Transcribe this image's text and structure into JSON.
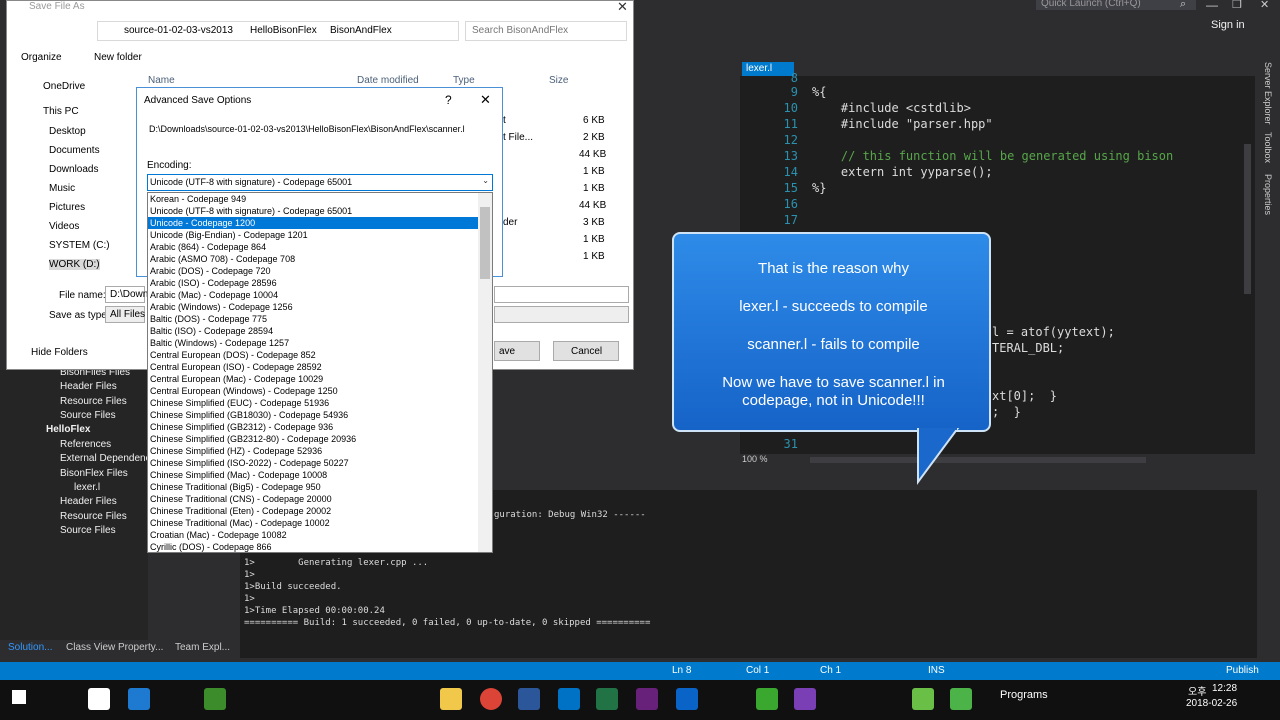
{
  "ide": {
    "quick_launch": "Quick Launch (Ctrl+Q)",
    "sign_in": "Sign in",
    "editor_tab": "lexer.l",
    "gutter": [
      "8",
      "9",
      "10",
      "11",
      "12",
      "13",
      "14",
      "15",
      "16",
      "17",
      "31"
    ],
    "code": [
      "%{",
      "    #include <cstdlib>",
      "    #include \"parser.hpp\"",
      "",
      "    // this function will be generated using bison",
      "    extern int yyparse();",
      "%}"
    ],
    "partial_code": [
      "l = atof(yytext);",
      "TERAL_DBL;",
      "xt[0];  }",
      ";  }"
    ],
    "zoom": "100 %",
    "side_tabs": [
      "Server Explorer",
      "Toolbox",
      "Properties"
    ]
  },
  "solution": {
    "items": [
      "BisonFiles Files",
      "Header Files",
      "Resource Files",
      "Source Files",
      "HelloFlex",
      "References",
      "External Dependencies",
      "BisonFlex Files",
      "lexer.l",
      "Header Files",
      "Resource Files",
      "Source Files"
    ],
    "tabs": [
      "Solution...",
      "Class View",
      "Property...",
      "Team Expl..."
    ]
  },
  "output": {
    "config_line": "guration: Debug Win32 ------",
    "lines": [
      "1>        Generating lexer.cpp ...",
      "1>",
      "1>Build succeeded.",
      "1>",
      "1>Time Elapsed 00:00:00.24",
      "========== Build: 1 succeeded, 0 failed, 0 up-to-date, 0 skipped =========="
    ]
  },
  "status": {
    "ln": "Ln 8",
    "col": "Col 1",
    "ch": "Ch 1",
    "ins": "INS",
    "publish": "Publish"
  },
  "taskbar": {
    "programs": "Programs",
    "time": "12:28",
    "ampm": "오후",
    "date": "2018-02-26"
  },
  "save_dialog": {
    "title": "Save File As",
    "path": [
      "source-01-02-03-vs2013",
      "HelloBisonFlex",
      "BisonAndFlex"
    ],
    "search": "Search BisonAndFlex",
    "organize": "Organize",
    "new_folder": "New folder",
    "columns": [
      "Name",
      "Date modified",
      "Type",
      "Size"
    ],
    "nav": [
      "OneDrive",
      "This PC",
      "Desktop",
      "Documents",
      "Downloads",
      "Music",
      "Pictures",
      "Videos",
      "SYSTEM (C:)",
      "WORK (D:)"
    ],
    "sizes": [
      "6 KB",
      "2 KB",
      "44 KB",
      "1 KB",
      "1 KB",
      "44 KB",
      "3 KB",
      "1 KB",
      "1 KB"
    ],
    "type_frag": [
      "t",
      "t File...",
      "",
      "",
      "",
      "",
      "der",
      "",
      ""
    ],
    "file_name_label": "File name:",
    "file_name": "D:\\Down",
    "save_as_label": "Save as type:",
    "save_as": "All Files",
    "hide_folders": "Hide Folders",
    "save": "ave",
    "cancel": "Cancel"
  },
  "advanced": {
    "title": "Advanced Save Options",
    "path": "D:\\Downloads\\source-01-02-03-vs2013\\HelloBisonFlex\\BisonAndFlex\\scanner.l",
    "encoding_label": "Encoding:",
    "selected": "Unicode (UTF-8 with signature) - Codepage 65001",
    "options": [
      "Korean - Codepage 949",
      "Unicode (UTF-8 with signature) - Codepage 65001",
      "Unicode - Codepage 1200",
      "Unicode (Big-Endian) - Codepage 1201",
      "Arabic (864) - Codepage 864",
      "Arabic (ASMO 708) - Codepage 708",
      "Arabic (DOS) - Codepage 720",
      "Arabic (ISO) - Codepage 28596",
      "Arabic (Mac) - Codepage 10004",
      "Arabic (Windows) - Codepage 1256",
      "Baltic (DOS) - Codepage 775",
      "Baltic (ISO) - Codepage 28594",
      "Baltic (Windows) - Codepage 1257",
      "Central European (DOS) - Codepage 852",
      "Central European (ISO) - Codepage 28592",
      "Central European (Mac) - Codepage 10029",
      "Central European (Windows) - Codepage 1250",
      "Chinese Simplified (EUC) - Codepage 51936",
      "Chinese Simplified (GB18030) - Codepage 54936",
      "Chinese Simplified (GB2312) - Codepage 936",
      "Chinese Simplified (GB2312-80) - Codepage 20936",
      "Chinese Simplified (HZ) - Codepage 52936",
      "Chinese Simplified (ISO-2022) - Codepage 50227",
      "Chinese Simplified (Mac) - Codepage 10008",
      "Chinese Traditional (Big5) - Codepage 950",
      "Chinese Traditional (CNS) - Codepage 20000",
      "Chinese Traditional (Eten) - Codepage 20002",
      "Chinese Traditional (Mac) - Codepage 10002",
      "Croatian (Mac) - Codepage 10082",
      "Cyrillic (DOS) - Codepage 866"
    ],
    "selected_index": 2
  },
  "callout": {
    "lines": [
      "That is the reason why",
      "lexer.l - succeeds to compile",
      "scanner.l - fails to compile",
      "Now we have to save scanner.l in codepage, not in Unicode!!!"
    ]
  }
}
